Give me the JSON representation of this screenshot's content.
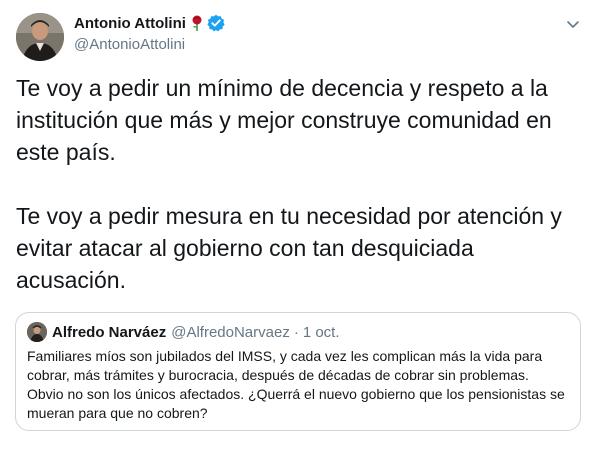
{
  "tweet": {
    "author": {
      "display_name": "Antonio Attolini",
      "handle": "@AntonioAttolini",
      "avatar_icon": "profile-photo",
      "badges": [
        "rose-icon",
        "verified-icon"
      ]
    },
    "paragraphs": [
      "Te voy a pedir un mínimo de decencia y respeto a la institución que más y mejor construye comunidad en este país.",
      "Te voy a pedir mesura en tu necesidad por atención y evitar atacar al gobierno con tan desquiciada acusación."
    ],
    "menu_icon": "chevron-down-icon"
  },
  "quoted_tweet": {
    "display_name": "Alfredo Narváez",
    "handle": "@AlfredoNarvaez",
    "separator": "·",
    "time": "1 oct.",
    "text": "Familiares míos son jubilados del IMSS, y cada vez les complican más la vida para cobrar, más trámites y burocracia, después de décadas de cobrar sin problemas. Obvio no son los únicos afectados. ¿Querrá el nuevo gobierno que los pensionistas se mueran para que no cobren?"
  },
  "colors": {
    "text": "#14171a",
    "secondary": "#657786",
    "verified": "#1da1f2",
    "border": "#ccd6dd",
    "rose": "#c0142c"
  }
}
